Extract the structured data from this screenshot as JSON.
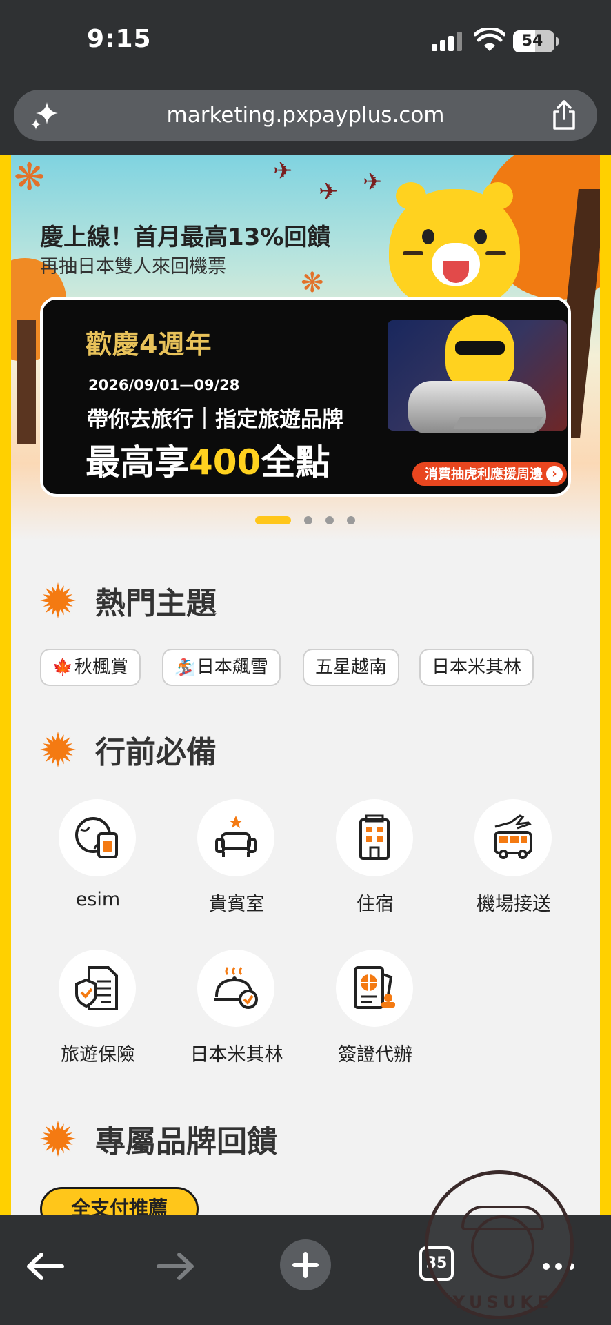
{
  "status_bar": {
    "time": "9:15",
    "battery": "54",
    "battery_level": 0.54
  },
  "browser": {
    "url": "marketing.pxpayplus.com",
    "tab_count": "35"
  },
  "hero": {
    "title": "慶上線！首月最高13%回饋",
    "subtitle": "再抽日本雙人來回機票"
  },
  "banner": {
    "logo_text": "歡慶4週年",
    "date_range": "2026/09/01—09/28",
    "line1": "帶你去旅行｜指定旅遊品牌",
    "line2_prefix": "最高享",
    "line2_highlight": "400",
    "line2_suffix": "全點",
    "cta": "消費抽虎利應援周邊",
    "cta_arrow": "›"
  },
  "carousel": {
    "count": 4,
    "active_index": 0
  },
  "sections": {
    "hot_topics": {
      "title": "熱門主題",
      "chips": [
        {
          "icon": "maple-leaf-icon",
          "glyph": "🍁",
          "label": "秋楓賞"
        },
        {
          "icon": "snowboard-icon",
          "glyph": "🏂",
          "label": "日本飆雪"
        },
        {
          "icon": "",
          "glyph": "",
          "label": "五星越南"
        },
        {
          "icon": "",
          "glyph": "",
          "label": "日本米其林"
        }
      ]
    },
    "travel_prep": {
      "title": "行前必備",
      "items": [
        {
          "label": "esim",
          "icon": "esim-icon"
        },
        {
          "label": "貴賓室",
          "icon": "lounge-seat-icon"
        },
        {
          "label": "住宿",
          "icon": "hotel-icon"
        },
        {
          "label": "機場接送",
          "icon": "airport-shuttle-icon"
        },
        {
          "label": "旅遊保險",
          "icon": "insurance-icon"
        },
        {
          "label": "日本米其林",
          "icon": "dining-cloche-icon"
        },
        {
          "label": "簽證代辦",
          "icon": "passport-icon"
        }
      ]
    },
    "brand_rewards": {
      "title": "專屬品牌回饋",
      "pill": "全支付推薦"
    }
  },
  "watermark": {
    "text": "YUSUKE"
  },
  "colors": {
    "accent": "#f47a12",
    "brand_yellow": "#ffd000",
    "chrome": "#2f3133"
  }
}
